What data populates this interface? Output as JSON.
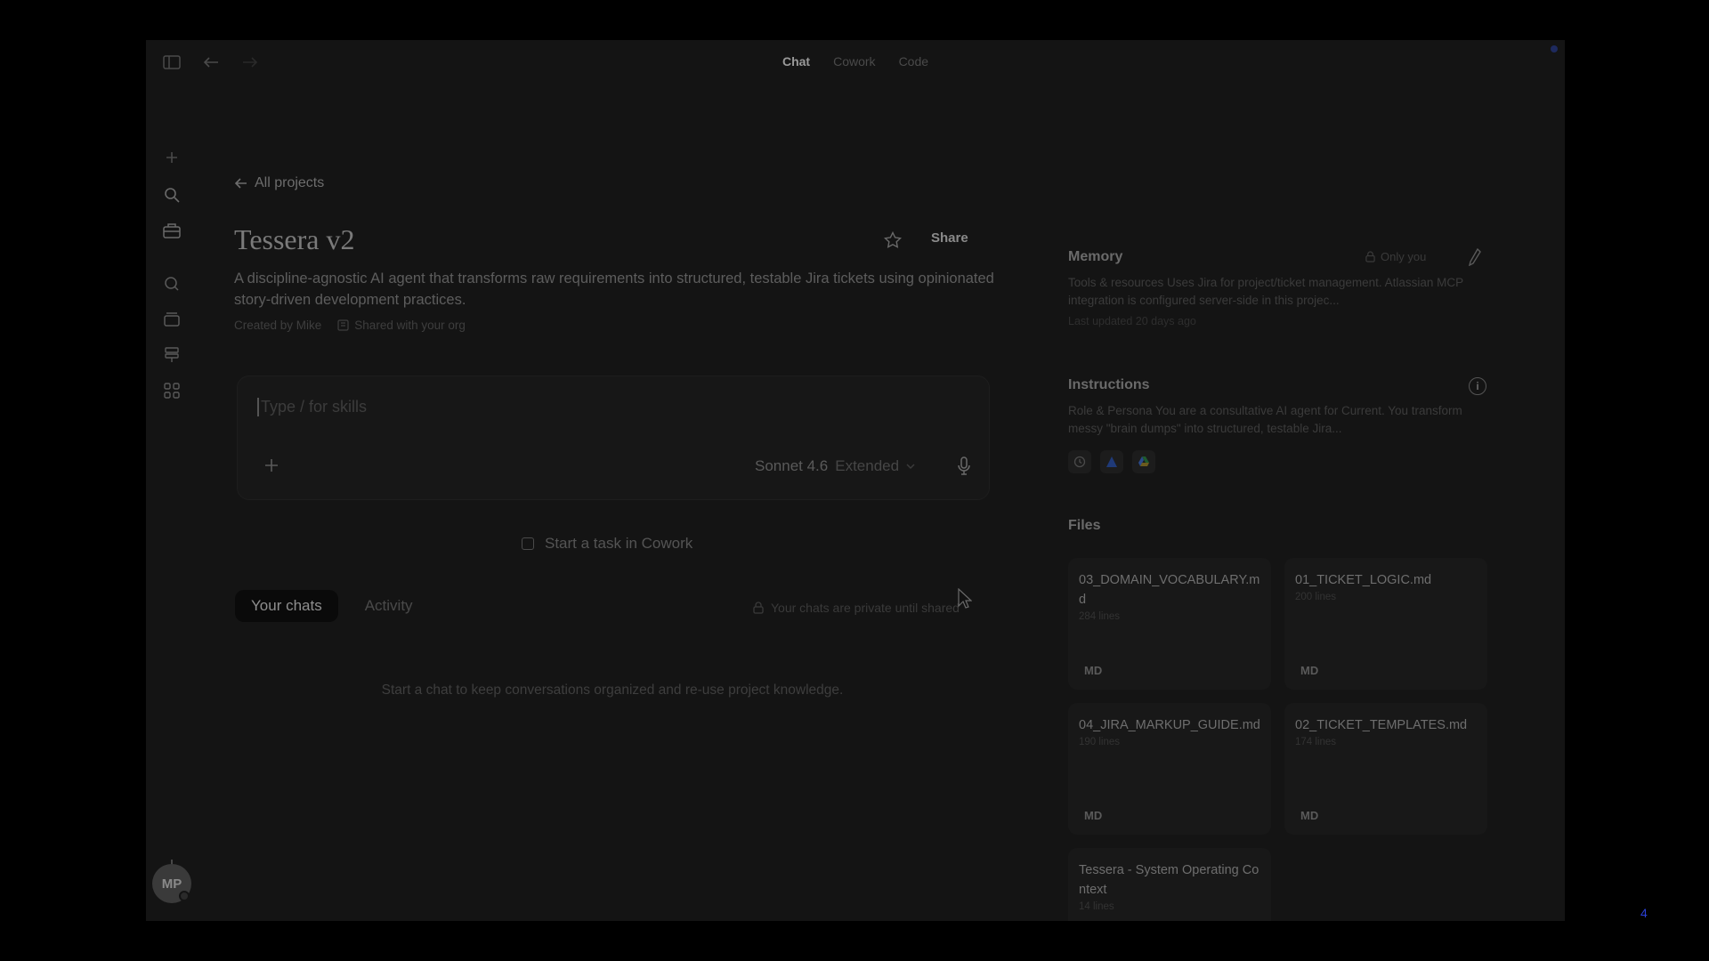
{
  "mode_tabs": [
    "Chat",
    "Cowork",
    "Code"
  ],
  "back_link": "All projects",
  "project": {
    "title": "Tessera v2",
    "share_label": "Share",
    "description": "A discipline-agnostic AI agent that transforms raw requirements into structured, testable Jira tickets using opinionated story-driven development practices.",
    "created_by": "Created by Mike",
    "shared": "Shared with your org"
  },
  "composer": {
    "placeholder": "Type / for skills",
    "model": "Sonnet 4.6",
    "mode": "Extended"
  },
  "cowork_task": "Start a task in Cowork",
  "chat_tabs": [
    "Your chats",
    "Activity"
  ],
  "private_note": "Your chats are private until shared",
  "empty_note": "Start a chat to keep conversations organized and re-use project knowledge.",
  "memory": {
    "title": "Memory",
    "only_you": "Only you",
    "text": "Tools & resources Uses Jira for project/ticket management. Atlassian MCP integration is configured server-side in this projec...",
    "updated": "Last updated 20 days ago"
  },
  "instructions": {
    "title": "Instructions",
    "info": "i",
    "text": "Role & Persona You are a consultative AI agent for Current. You transform messy \"brain dumps\" into structured, testable Jira..."
  },
  "files": {
    "title": "Files",
    "items": [
      {
        "name": "03_DOMAIN_VOCABULARY.md",
        "lines": "284 lines",
        "type": "MD"
      },
      {
        "name": "01_TICKET_LOGIC.md",
        "lines": "200 lines",
        "type": "MD"
      },
      {
        "name": "04_JIRA_MARKUP_GUIDE.md",
        "lines": "190 lines",
        "type": "MD"
      },
      {
        "name": "02_TICKET_TEMPLATES.md",
        "lines": "174 lines",
        "type": "MD"
      },
      {
        "name": "Tessera - System Operating Context",
        "lines": "14 lines",
        "type": ""
      }
    ]
  },
  "avatar_initials": "MP",
  "slide_number": "4",
  "colors": {
    "app_bg": "#141414",
    "accent_blue": "#2a3fd6"
  }
}
